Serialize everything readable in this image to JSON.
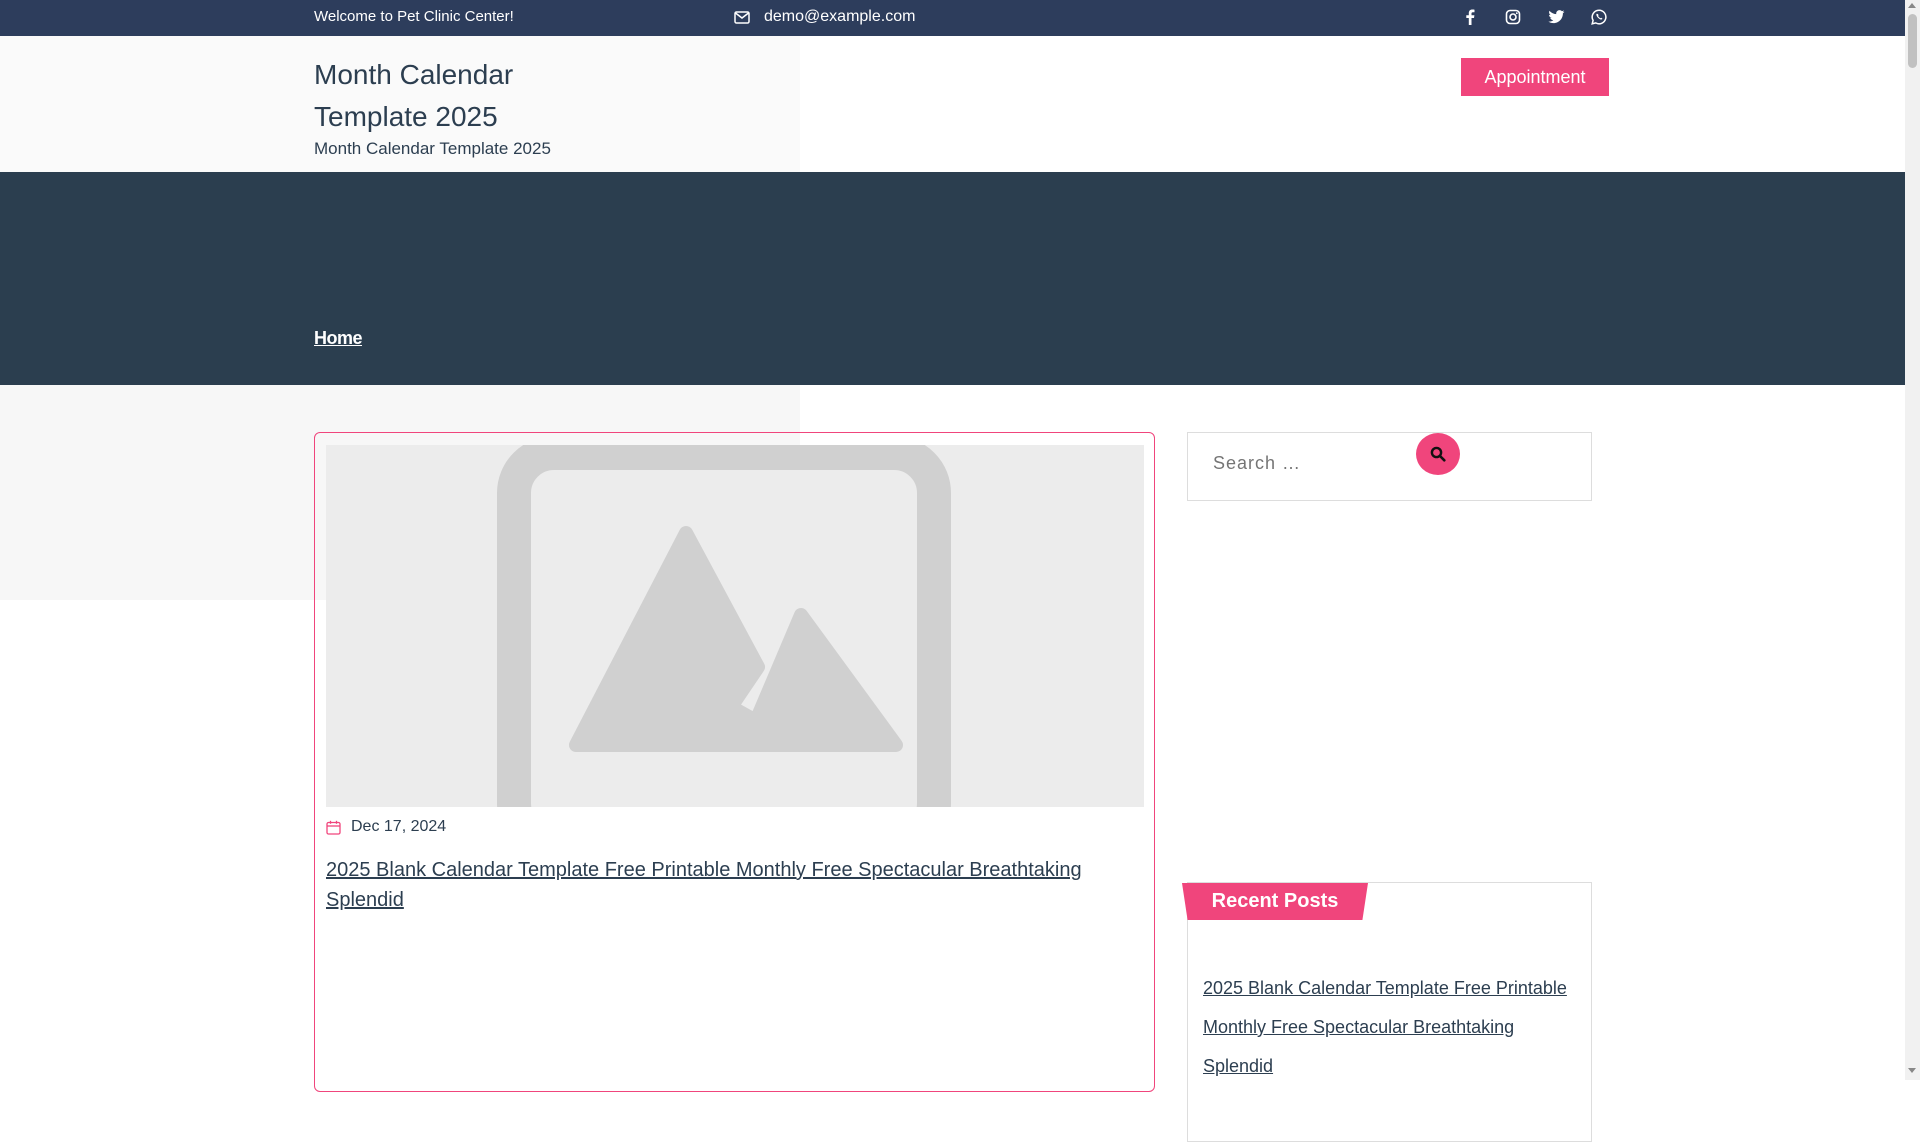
{
  "topbar": {
    "welcome": "Welcome to Pet Clinic Center!",
    "email": "demo@example.com",
    "email_icon": "envelope-icon",
    "social": [
      "facebook-icon",
      "instagram-icon",
      "twitter-icon",
      "whatsapp-icon"
    ]
  },
  "header": {
    "site_title": "Month Calendar Template 2025",
    "tagline": "Month Calendar Template 2025",
    "appointment_label": "Appointment"
  },
  "hero": {
    "breadcrumb": "Home"
  },
  "post": {
    "image_icon": "image-placeholder-icon",
    "date_icon": "calendar-icon",
    "date": "Dec 17, 2024",
    "title": "2025 Blank Calendar Template Free Printable Monthly Free Spectacular Breathtaking Splendid"
  },
  "sidebar": {
    "search": {
      "placeholder": "Search …",
      "button_icon": "search-icon"
    },
    "recent_posts": {
      "heading": "Recent Posts",
      "items": [
        "2025 Blank Calendar Template Free Printable Monthly Free Spectacular Breathtaking Splendid"
      ]
    }
  },
  "colors": {
    "topbar": "#2d3d5c",
    "hero": "#2b3e4f",
    "accent": "#f0457c",
    "text": "#2c3e50"
  }
}
